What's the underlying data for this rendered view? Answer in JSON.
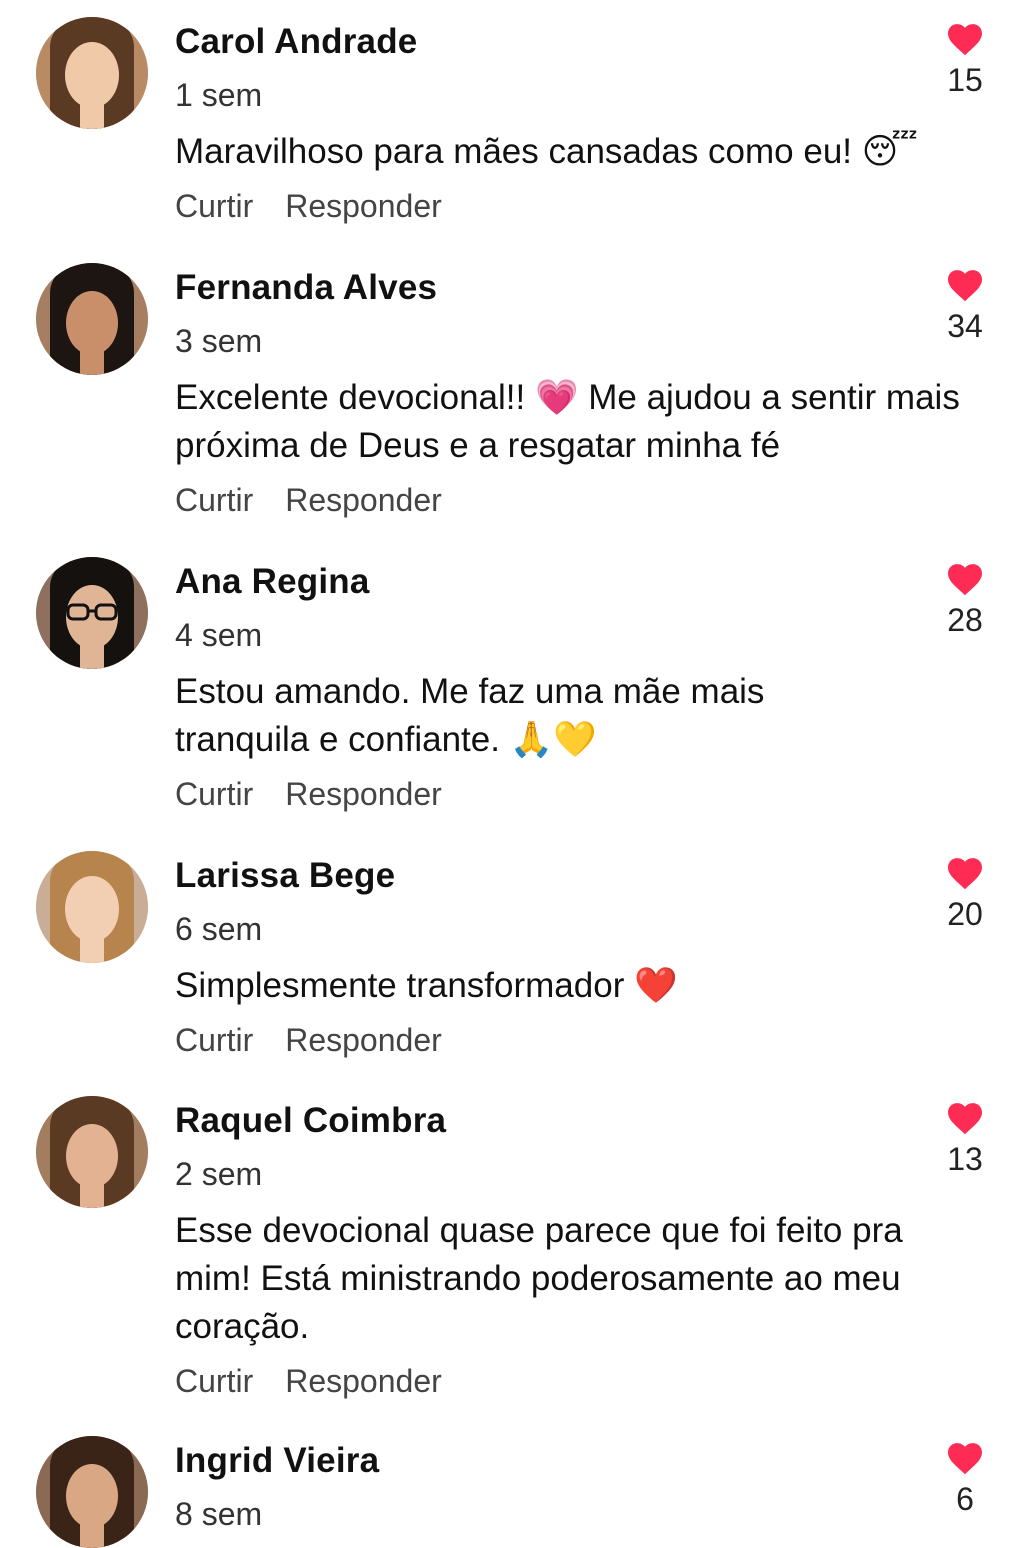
{
  "colors": {
    "heart": "#fe2c55",
    "text": "#111111",
    "muted": "#444444"
  },
  "comments": [
    {
      "name": "Carol Andrade",
      "time": "1 sem",
      "likes": "15",
      "text": "Maravilhoso para mães cansadas como eu! 😴",
      "like_label": "Curtir",
      "reply_label": "Responder",
      "heart_icon": "heart-icon"
    },
    {
      "name": "Fernanda Alves",
      "time": "3 sem",
      "likes": "34",
      "text": "Excelente devocional!! 💗 Me ajudou a sentir mais próxima de Deus e a resgatar minha fé",
      "like_label": "Curtir",
      "reply_label": "Responder",
      "heart_icon": "heart-icon"
    },
    {
      "name": "Ana Regina",
      "time": "4 sem",
      "likes": "28",
      "text": "Estou amando. Me faz uma mãe mais tranquila e confiante. 🙏💛",
      "like_label": "Curtir",
      "reply_label": "Responder",
      "heart_icon": "heart-icon"
    },
    {
      "name": "Larissa Bege",
      "time": "6 sem",
      "likes": "20",
      "text": "Simplesmente transformador ❤️",
      "like_label": "Curtir",
      "reply_label": "Responder",
      "heart_icon": "heart-icon"
    },
    {
      "name": "Raquel Coimbra",
      "time": "2 sem",
      "likes": "13",
      "text": "Esse devocional quase parece que foi feito pra mim! Está ministrando poderosamente ao meu coração.",
      "like_label": "Curtir",
      "reply_label": "Responder",
      "heart_icon": "heart-icon"
    },
    {
      "name": "Ingrid Vieira",
      "time": "8 sem",
      "likes": "6",
      "text": "",
      "like_label": "",
      "reply_label": "",
      "heart_icon": "heart-icon"
    }
  ]
}
